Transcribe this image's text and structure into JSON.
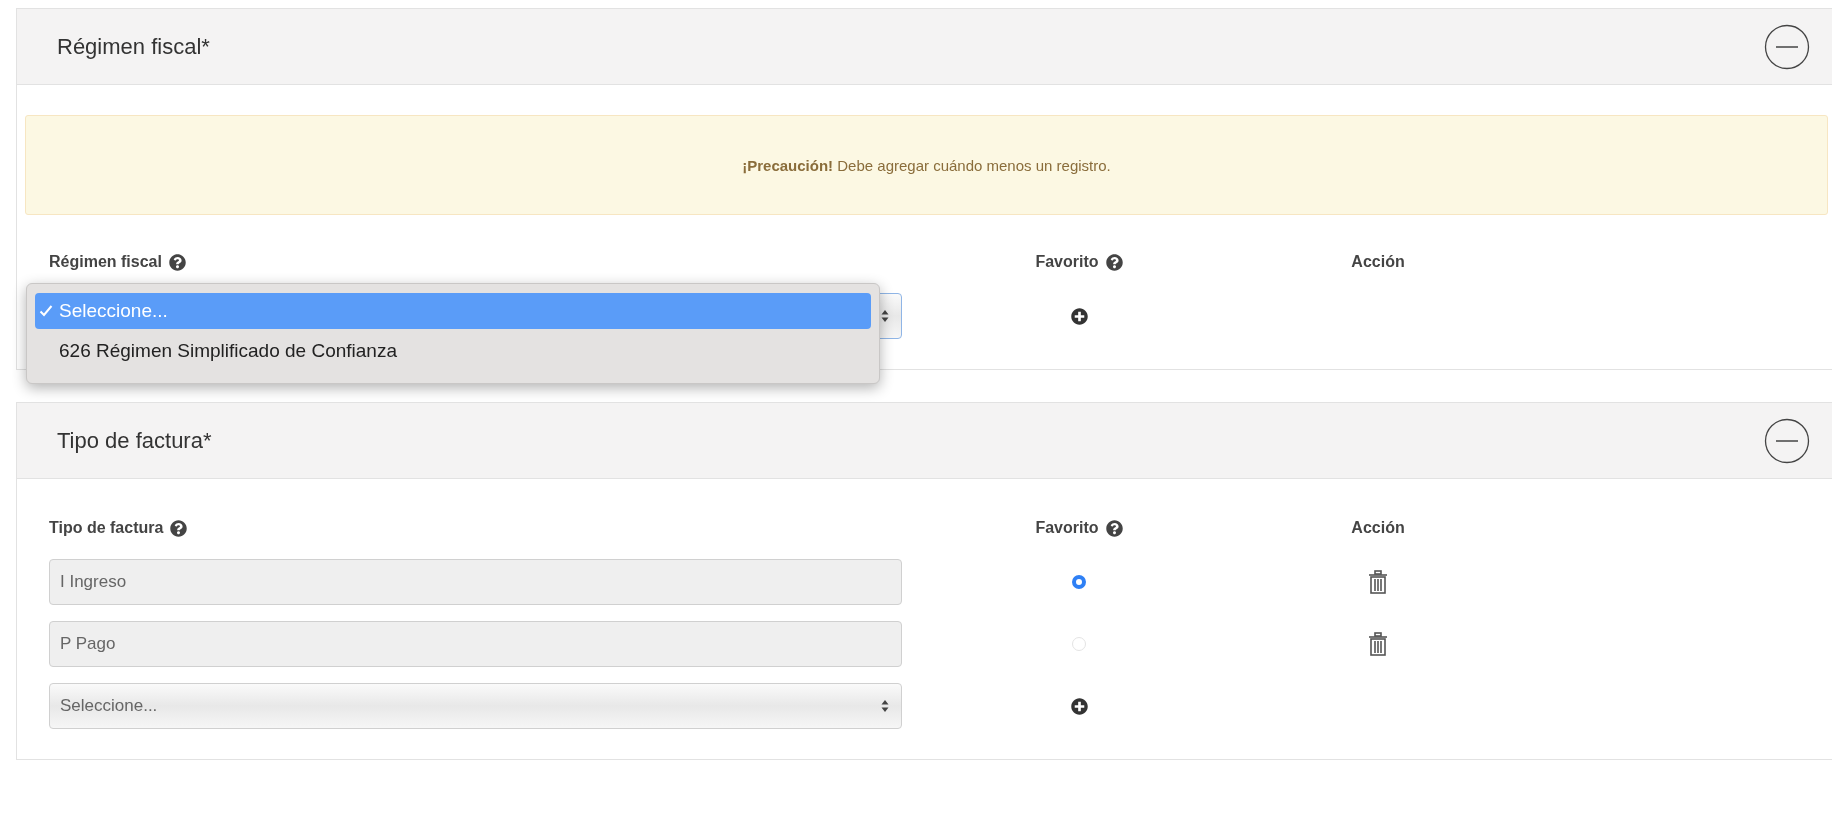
{
  "sections": [
    {
      "title": "Régimen fiscal*",
      "expanded": true,
      "alert": "**¡Precaución!** Debe agregar cuándo menos un registro.",
      "columns": [
        "Régimen fiscal",
        "Favorito",
        "Acción"
      ],
      "rows": [
        {
          "kind": "select",
          "open": true,
          "options": [
            {
              "label": "Seleccione...",
              "selected": true
            },
            {
              "label": "626 Régimen Simplificado de Confianza",
              "selected": false
            }
          ]
        }
      ]
    },
    {
      "title": "Tipo de factura*",
      "expanded": true,
      "columns": [
        "Tipo de factura",
        "Favorito",
        "Acción"
      ],
      "rows": [
        {
          "kind": "value",
          "value": "I Ingreso",
          "favorite": true
        },
        {
          "kind": "value",
          "value": "P Pago",
          "favorite": false
        },
        {
          "kind": "select",
          "open": false,
          "value": "Seleccione..."
        }
      ]
    }
  ]
}
